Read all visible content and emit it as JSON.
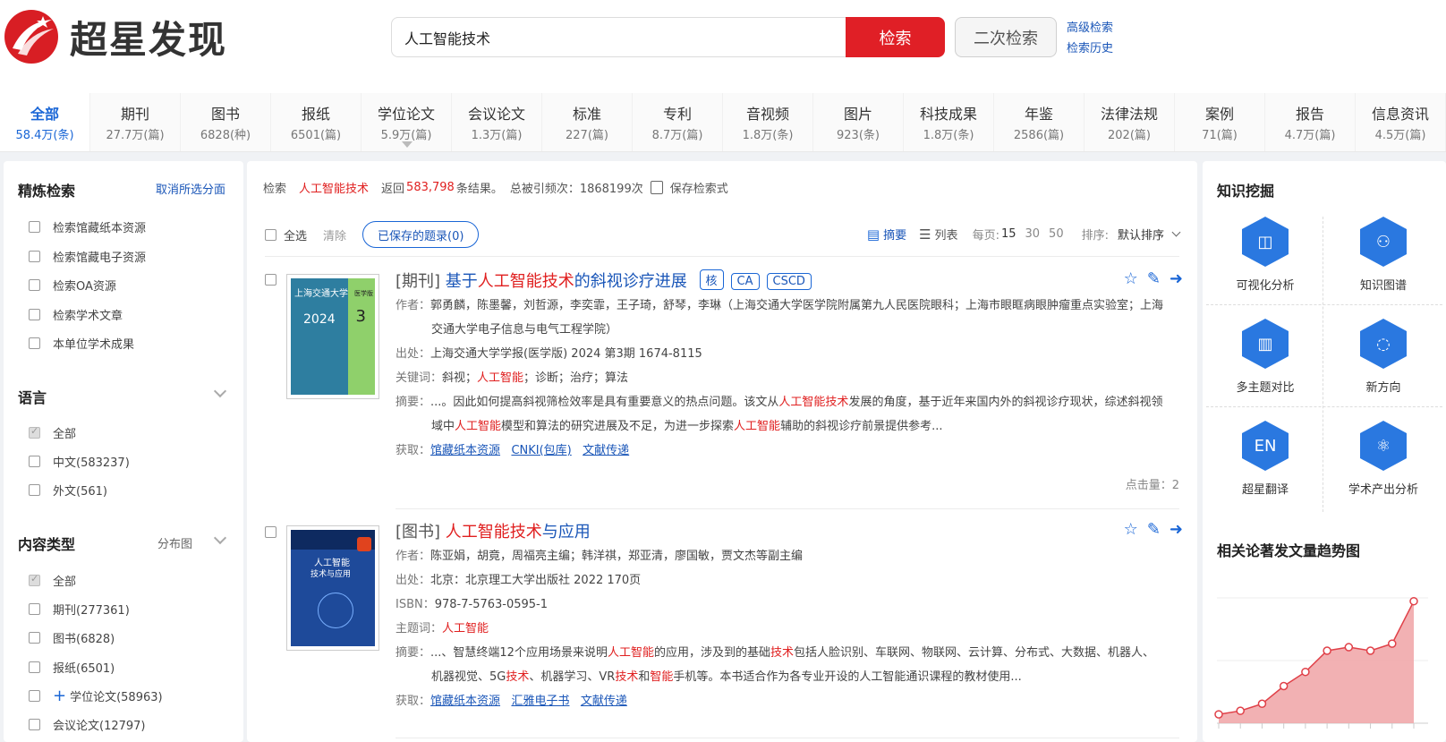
{
  "header": {
    "logo_text": "超星发现",
    "search_value": "人工智能技术",
    "search_btn": "检索",
    "second_btn": "二次检索",
    "adv_search": "高级检索",
    "history": "检索历史"
  },
  "tabs": [
    {
      "name": "全部",
      "count": "58.4万(条)"
    },
    {
      "name": "期刊",
      "count": "27.7万(篇)"
    },
    {
      "name": "图书",
      "count": "6828(种)"
    },
    {
      "name": "报纸",
      "count": "6501(篇)"
    },
    {
      "name": "学位论文",
      "count": "5.9万(篇)"
    },
    {
      "name": "会议论文",
      "count": "1.3万(篇)"
    },
    {
      "name": "标准",
      "count": "227(篇)"
    },
    {
      "name": "专利",
      "count": "8.7万(篇)"
    },
    {
      "name": "音视频",
      "count": "1.8万(条)"
    },
    {
      "name": "图片",
      "count": "923(条)"
    },
    {
      "name": "科技成果",
      "count": "1.8万(条)"
    },
    {
      "name": "年鉴",
      "count": "2586(篇)"
    },
    {
      "name": "法律法规",
      "count": "202(篇)"
    },
    {
      "name": "案例",
      "count": "71(篇)"
    },
    {
      "name": "报告",
      "count": "4.7万(篇)"
    },
    {
      "name": "信息资讯",
      "count": "4.5万(篇)"
    }
  ],
  "left": {
    "refine_title": "精炼检索",
    "cancel_facets": "取消所选分面",
    "refine_items": [
      "检索馆藏纸本资源",
      "检索馆藏电子资源",
      "检索OA资源",
      "检索学术文章",
      "本单位学术成果"
    ],
    "lang_title": "语言",
    "lang_items": [
      "全部",
      "中文(583237)",
      "外文(561)"
    ],
    "type_title": "内容类型",
    "type_link": "分布图",
    "type_items": [
      "全部",
      "期刊(277361)",
      "图书(6828)",
      "报纸(6501)",
      "学位论文(58963)",
      "会议论文(12797)"
    ]
  },
  "summary": {
    "label": "检索",
    "term": "人工智能技术",
    "returned": "返回",
    "count": "583,798",
    "results": "条结果。",
    "cited": "总被引频次：1868199次",
    "save": "保存检索式"
  },
  "toolbar": {
    "select_all": "全选",
    "clear": "清除",
    "saved": "已保存的题录(0)",
    "abstract": "摘要",
    "list": "列表",
    "per_page": "每页:",
    "p15": "15",
    "p30": "30",
    "p50": "50",
    "sort": "排序:",
    "sort_value": "默认排序"
  },
  "rec1": {
    "type": "[期刊]",
    "t1": "基于",
    "t2": "人工智能技术",
    "t3": "的斜视诊疗进展",
    "badges": [
      "核",
      "CA",
      "CSCD"
    ],
    "author_lab": "作者：",
    "authors": "郭勇麟，陈墨馨，刘哲源，李奕霏，王子琦，舒琴，李琳（上海交通大学医学院附属第九人民医院眼科；上海市眼眶病眼肿瘤重点实验室；上海交通大学电子信息与电气工程学院）",
    "source_lab": "出处：",
    "source": "上海交通大学学报(医学版) 2024 第3期  1674-8115",
    "kw_lab": "关键词：",
    "kw1": "斜视；",
    "kw2": "人工智能",
    "kw3": "；诊断；治疗；算法",
    "abs_lab": "摘要：",
    "abs1": "...。因此如何提高斜视筛检效率是具有重要意义的热点问题。该文从",
    "abs2": "人工智能技术",
    "abs3": "发展的角度，基于近年来国内外的斜视诊疗现状，综述斜视领域中",
    "abs4": "人工智能",
    "abs5": "模型和算法的研究进展及不足，为进一步探索",
    "abs6": "人工智能",
    "abs7": "辅助的斜视诊疗前景提供参考...",
    "get_lab": "获取：",
    "links": [
      "馆藏纸本资源",
      "CNKI(包库)",
      "文献传递"
    ],
    "clicks": "点击量：2",
    "cover_title": "上海交通大学",
    "cover_year": "2024",
    "cover_num": "3",
    "cover_sub": "医学版"
  },
  "rec2": {
    "type": "[图书]",
    "t1": "人工智能技术",
    "t2": "与应用",
    "author_lab": "作者：",
    "authors": "陈亚娟，胡竟，周福亮主编；韩洋祺，郑亚清，廖国敏，贾文杰等副主编",
    "source_lab": "出处：",
    "source": "北京：北京理工大学出版社 2022 170页",
    "isbn_lab": "ISBN：",
    "isbn": "978-7-5763-0595-1",
    "subj_lab": "主题词：",
    "subj": "人工智能",
    "abs_lab": "摘要：",
    "abs1": "...、智慧终端12个应用场景来说明",
    "abs2": "人工智能",
    "abs3": "的应用，涉及到的基础",
    "abs4": "技术",
    "abs5": "包括人脸识别、车联网、物联网、云计算、分布式、大数据、机器人、机器视觉、5G",
    "abs6": "技术",
    "abs7": "、机器学习、VR",
    "abs8": "技术",
    "abs9": "和",
    "abs10": "智能",
    "abs11": "手机等。本书适合作为各专业开设的人工智能通识课程的教材使用...",
    "get_lab": "获取：",
    "links": [
      "馆藏纸本资源",
      "汇雅电子书",
      "文献传递"
    ],
    "cover_title": "人工智能",
    "cover_sub": "技术与应用"
  },
  "right": {
    "title": "知识挖掘",
    "tools": [
      {
        "label": "可视化分析",
        "icon": "chart-icon"
      },
      {
        "label": "知识图谱",
        "icon": "graph-icon"
      },
      {
        "label": "多主题对比",
        "icon": "bar-icon"
      },
      {
        "label": "新方向",
        "icon": "direction-icon"
      },
      {
        "label": "超星翻译",
        "icon": "translate-icon"
      },
      {
        "label": "学术产出分析",
        "icon": "atom-icon"
      }
    ],
    "trend_title": "相关论著发文量趋势图"
  },
  "chart_data": {
    "type": "area",
    "x": [
      1,
      2,
      3,
      4,
      5,
      6,
      7,
      8,
      9,
      10
    ],
    "values": [
      2,
      3,
      5,
      10,
      14,
      20,
      21,
      20,
      22,
      34
    ],
    "ylim": [
      0,
      40
    ]
  },
  "colors": {
    "accent": "#1a66d6",
    "brand_red": "#e01f26"
  }
}
